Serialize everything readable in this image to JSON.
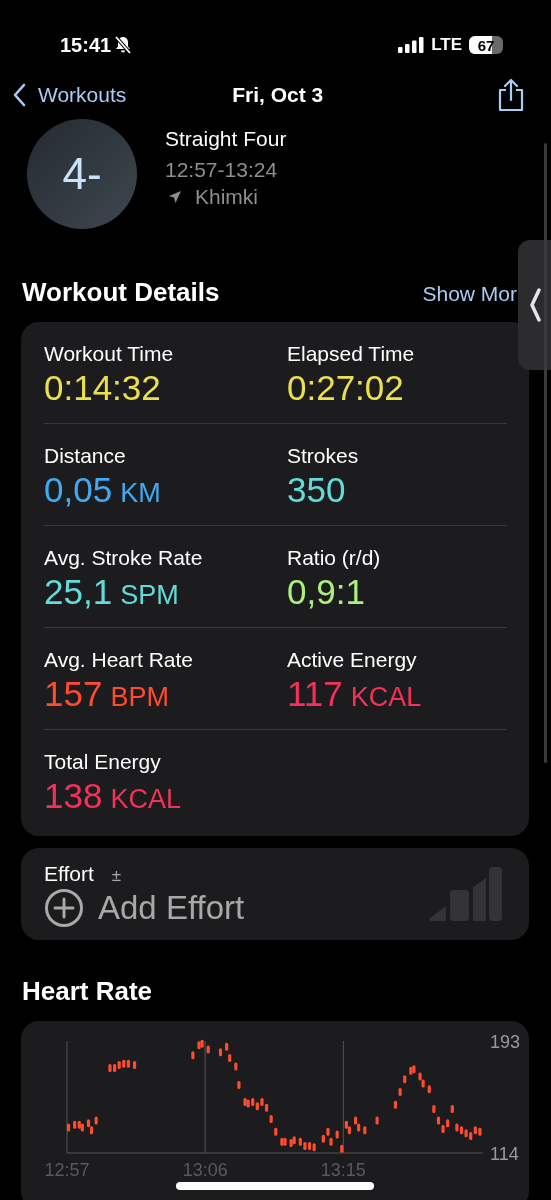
{
  "status_bar": {
    "time": "15:41",
    "network": "LTE",
    "battery": "67"
  },
  "nav": {
    "back": "Workouts",
    "title": "Fri, Oct 3"
  },
  "workout": {
    "badge": "4-",
    "name": "Straight Four",
    "time_range": "12:57-13:24",
    "location": "Khimki"
  },
  "details": {
    "title": "Workout Details",
    "show_more": "Show Mor",
    "metrics": [
      {
        "label": "Workout Time",
        "value": "0:14:32",
        "color": "#ebe04c"
      },
      {
        "label": "Elapsed Time",
        "value": "0:27:02",
        "color": "#ebe04c"
      },
      {
        "label": "Distance",
        "value": "0,05",
        "unit": "KM",
        "color": "#40a9f3"
      },
      {
        "label": "Strokes",
        "value": "350",
        "color": "#62dcd9"
      },
      {
        "label": "Avg. Stroke Rate",
        "value": "25,1",
        "unit": "SPM",
        "color": "#62dcd9"
      },
      {
        "label": "Ratio (r/d)",
        "value": "0,9:1",
        "color": "#a9f07d"
      },
      {
        "label": "Avg. Heart Rate",
        "value": "157",
        "unit": "BPM",
        "color": "#ff4b2e"
      },
      {
        "label": "Active Energy",
        "value": "117",
        "unit": "KCAL",
        "color": "#f5305a"
      },
      {
        "label": "Total Energy",
        "value": "138",
        "unit": "KCAL",
        "color": "#f5305a"
      }
    ]
  },
  "effort": {
    "label": "Effort",
    "sign": "±",
    "action": "Add Effort"
  },
  "heart_rate": {
    "title": "Heart Rate",
    "chart_data": {
      "type": "scatter",
      "xlim": [
        777,
        804.1
      ],
      "ylim": [
        114,
        193
      ],
      "yticks": [
        114,
        193
      ],
      "xticks": [
        {
          "value": 777,
          "label": "12:57"
        },
        {
          "value": 786,
          "label": "13:06"
        },
        {
          "value": 795,
          "label": "13:15"
        }
      ],
      "series": [
        {
          "color": "#ff4b2e",
          "x": [
            777.1,
            777.5,
            777.8,
            778.0,
            778.4,
            778.6,
            778.9,
            779.8,
            780.1,
            780.4,
            780.7,
            781.0,
            781.4,
            785.2,
            785.6,
            785.8,
            786.2,
            787.0,
            787.4,
            787.6,
            788.0,
            788.2,
            788.6,
            788.8,
            789.1,
            789.4,
            789.7,
            790.0,
            790.3,
            790.6,
            791.0,
            791.2,
            791.6,
            791.8,
            792.2,
            792.5,
            792.8,
            793.1,
            793.7,
            794.0,
            794.2,
            794.6,
            794.9,
            795.2,
            795.4,
            795.8,
            796.0,
            796.4,
            797.2,
            798.4,
            798.7,
            799.0,
            799.4,
            799.6,
            800.0,
            800.2,
            800.6,
            800.9,
            801.2,
            801.5,
            801.8,
            802.1,
            802.4,
            802.7,
            803.0,
            803.3,
            803.6,
            803.9
          ],
          "values": [
            132,
            134,
            134,
            132,
            135,
            130,
            137,
            174,
            174,
            176,
            177,
            177,
            176,
            183,
            190,
            191,
            187,
            185,
            189,
            181,
            175,
            162,
            150,
            149,
            150,
            147,
            150,
            146,
            138,
            129,
            122,
            122,
            121,
            123,
            122,
            119,
            119,
            118,
            124,
            129,
            122,
            127,
            117,
            134,
            130,
            137,
            132,
            130,
            137,
            148,
            157,
            166,
            172,
            173,
            168,
            163,
            159,
            145,
            137,
            131,
            135,
            145,
            132,
            130,
            128,
            126,
            130,
            129
          ]
        }
      ]
    }
  }
}
